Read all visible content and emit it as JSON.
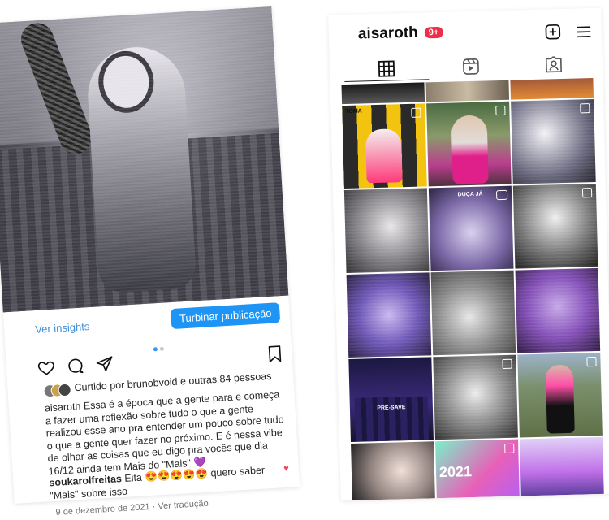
{
  "post": {
    "insights_label": "Ver insights",
    "boost_label": "Turbinar publicação",
    "liked_by_prefix": "Curtido por ",
    "liked_by_user": "brunobvoid",
    "liked_by_suffix": " e outras 84 pessoas",
    "caption_user": "aisaroth",
    "caption_text": " Essa é a época que a gente para e começa a fazer uma reflexão sobre tudo o que a gente realizou esse ano pra entender um pouco sobre tudo o que a gente quer fazer no próximo. E é nessa vibe de olhar as coisas que eu digo pra vocês que dia 16/12 ainda tem Mais do \"Mais\" 💜",
    "comment_user": "soukarolfreitas",
    "comment_text": " Eita 😍😍😍😍😍 quero saber \"Mais\" sobre isso",
    "date": "9 de dezembro de 2021",
    "separator": " · ",
    "translate_label": "Ver tradução",
    "carousel_index": 1,
    "carousel_count": 2
  },
  "profile": {
    "username": "aisaroth",
    "notification_badge": "9+",
    "tabs": [
      "posts-grid",
      "reels",
      "tagged"
    ],
    "active_tab": "posts-grid",
    "grid_text": {
      "toma_label": "TOMA",
      "duca_ja": "DUÇA JÁ",
      "pre_save": "PRÉ-SAVE",
      "year_label": "2021"
    }
  },
  "colors": {
    "accent_blue": "#1e95f5",
    "link_blue": "#3f8ed9",
    "badge_red": "#ee2e49",
    "heart_red": "#ed4956"
  }
}
